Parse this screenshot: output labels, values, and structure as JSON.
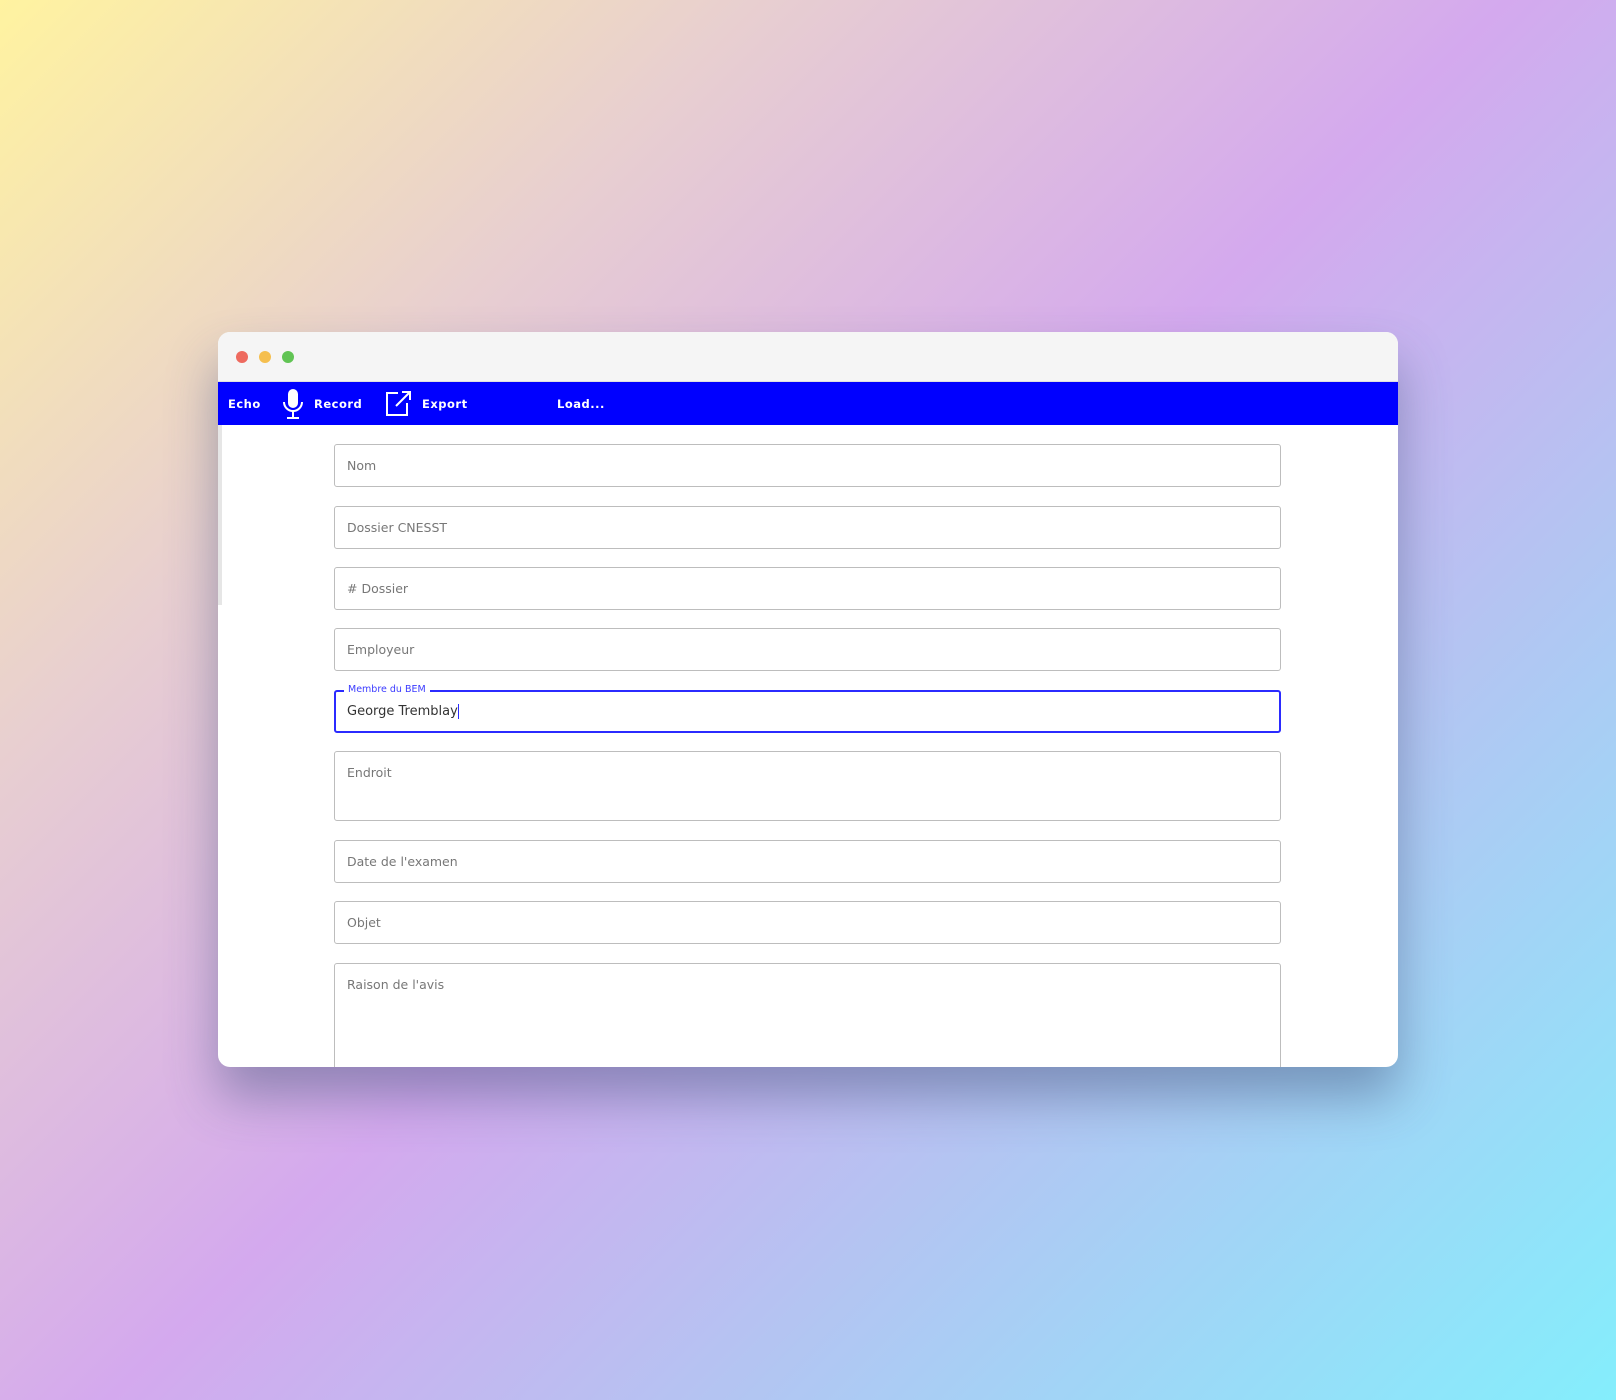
{
  "toolbar": {
    "app_name": "Echo",
    "record_label": "Record",
    "export_label": "Export",
    "load_label": "Load...",
    "accent": "#0000ff"
  },
  "window_controls": {
    "close_color": "#ee6a5f",
    "minimize_color": "#f5bf4f",
    "zoom_color": "#61c454"
  },
  "form": {
    "nom": {
      "placeholder": "Nom"
    },
    "dossier_cnesst": {
      "placeholder": "Dossier CNESST"
    },
    "num_dossier": {
      "placeholder": "# Dossier"
    },
    "employeur": {
      "placeholder": "Employeur"
    },
    "membre_bem": {
      "label": "Membre du BEM",
      "value": "George Tremblay"
    },
    "endroit": {
      "placeholder": "Endroit"
    },
    "date_examen": {
      "placeholder": "Date de l'examen"
    },
    "objet": {
      "placeholder": "Objet"
    },
    "raison_avis": {
      "placeholder": "Raison de l'avis"
    }
  }
}
